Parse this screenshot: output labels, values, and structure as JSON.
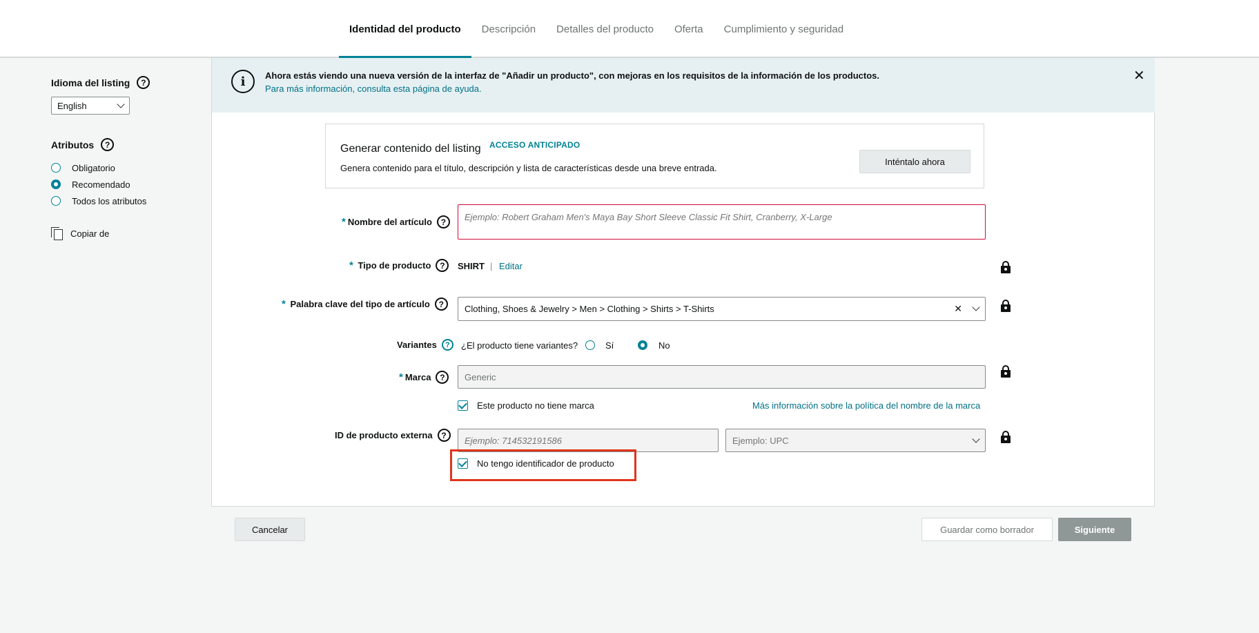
{
  "tabs": [
    {
      "label": "Identidad del producto",
      "active": true
    },
    {
      "label": "Descripción",
      "active": false
    },
    {
      "label": "Detalles del producto",
      "active": false
    },
    {
      "label": "Oferta",
      "active": false
    },
    {
      "label": "Cumplimiento y seguridad",
      "active": false
    }
  ],
  "sidebar": {
    "language_label": "Idioma del listing",
    "language_value": "English",
    "attributes_label": "Atributos",
    "attribute_options": [
      {
        "label": "Obligatorio",
        "selected": false
      },
      {
        "label": "Recomendado",
        "selected": true
      },
      {
        "label": "Todos los atributos",
        "selected": false
      }
    ],
    "copy_label": "Copiar de"
  },
  "banner": {
    "text": "Ahora estás viendo una nueva versión de la interfaz de \"Añadir un producto\", con mejoras en los requisitos de la información de los productos.",
    "link": "Para más información, consulta esta página de ayuda."
  },
  "generate": {
    "title": "Generar contenido del listing",
    "badge": "ACCESO ANTICIPADO",
    "subtitle": "Genera contenido para el título, descripción y lista de características desde una breve entrada.",
    "button": "Inténtalo ahora"
  },
  "form": {
    "item_name": {
      "label": "Nombre del artículo",
      "required": true,
      "placeholder": "Ejemplo: Robert Graham Men's Maya Bay Short Sleeve Classic Fit Shirt, Cranberry, X-Large"
    },
    "product_type": {
      "label": "Tipo de producto",
      "required": true,
      "value": "SHIRT",
      "separator": "|",
      "edit": "Editar"
    },
    "item_type_keyword": {
      "label": "Palabra clave del tipo de artículo",
      "required": true,
      "value": "Clothing, Shoes & Jewelry > Men > Clothing > Shirts > T-Shirts"
    },
    "variations": {
      "label": "Variantes",
      "question": "¿El producto tiene variantes?",
      "options": [
        {
          "label": "Sí",
          "selected": false
        },
        {
          "label": "No",
          "selected": true
        }
      ]
    },
    "brand": {
      "label": "Marca",
      "required": true,
      "value": "Generic",
      "no_brand_checkbox": "Este producto no tiene marca",
      "no_brand_checked": true,
      "policy_link": "Más información sobre la política del nombre de la marca"
    },
    "external_id": {
      "label": "ID de producto externa",
      "id_placeholder": "Ejemplo: 714532191586",
      "type_placeholder": "Ejemplo: UPC",
      "no_id_checkbox": "No tengo identificador de producto",
      "no_id_checked": true
    }
  },
  "footer": {
    "cancel": "Cancelar",
    "save_draft": "Guardar como borrador",
    "next": "Siguiente"
  },
  "colors": {
    "accent": "#008296",
    "link": "#007185",
    "highlight": "#e0341a"
  }
}
